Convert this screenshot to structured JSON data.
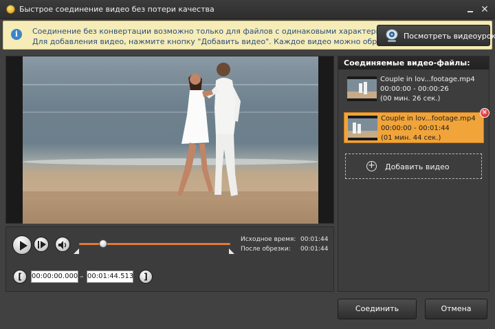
{
  "window": {
    "title": "Быстрое соединение видео без потери качества"
  },
  "info_bar": {
    "line1": "Соединение без конвертации возможно только для файлов с одинаковыми характеристиками.",
    "line2": "Для добавления видео, нажмите кнопку \"Добавить видео\". Каждое видео можно обрезать.",
    "tutorial_button": "Посмотреть видеоурок"
  },
  "player": {
    "source_time_label": "Исходное время:",
    "source_time_value": "00:01:44",
    "after_trim_label": "После обрезки:",
    "after_trim_value": "00:01:44",
    "trim_start": "00:00:00.000",
    "trim_end": "00:01:44.513",
    "dash": "–",
    "position_fraction": 0.16
  },
  "files": {
    "header": "Соединяемые видео-файлы:",
    "items": [
      {
        "name": "Couple in lov...footage.mp4",
        "range": "00:00:00 - 00:00:26",
        "duration": "(00 мин. 26 сек.)",
        "selected": false
      },
      {
        "name": "Couple in lov...footage.mp4",
        "range": "00:00:00 - 00:01:44",
        "duration": "(01 мин. 44 сек.)",
        "selected": true
      }
    ],
    "add_button": "Добавить видео"
  },
  "buttons": {
    "join": "Соединить",
    "cancel": "Отмена"
  },
  "colors": {
    "accent_orange": "#f0a43a",
    "info_bg": "#f6ecb8",
    "info_text": "#2a4f7a",
    "track": "#e07a3a"
  }
}
